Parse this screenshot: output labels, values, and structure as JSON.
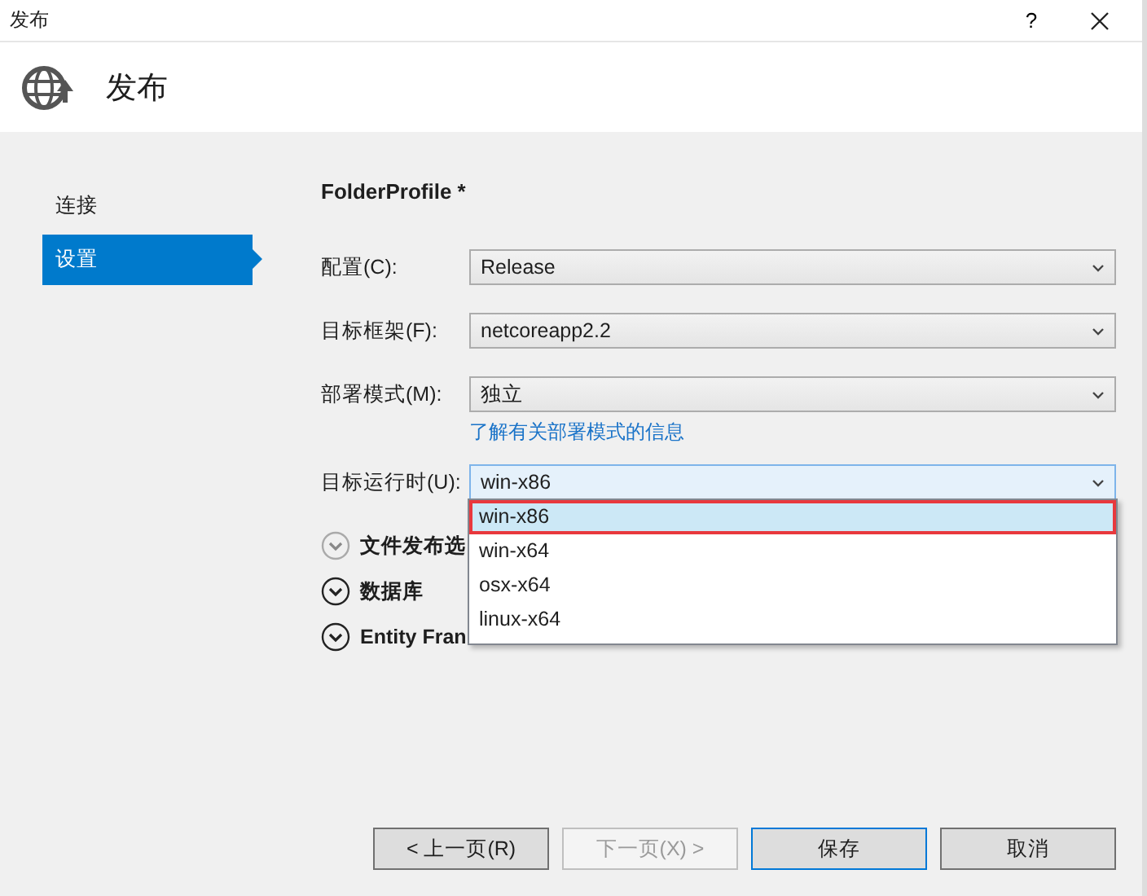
{
  "window": {
    "title": "发布",
    "help": "?"
  },
  "header": {
    "title": "发布"
  },
  "sidebar": {
    "items": [
      {
        "label": "连接",
        "selected": false
      },
      {
        "label": "设置",
        "selected": true
      }
    ]
  },
  "profile": {
    "title": "FolderProfile *"
  },
  "fields": [
    {
      "label": "配置(C):",
      "value": "Release",
      "open": false
    },
    {
      "label": "目标框架(F):",
      "value": "netcoreapp2.2",
      "open": false
    },
    {
      "label": "部署模式(M):",
      "value": "独立",
      "open": false,
      "link": "了解有关部署模式的信息"
    },
    {
      "label": "目标运行时(U):",
      "value": "win-x86",
      "open": true,
      "options": [
        {
          "label": "win-x86",
          "selected": true
        },
        {
          "label": "win-x64",
          "selected": false
        },
        {
          "label": "osx-x64",
          "selected": false
        },
        {
          "label": "linux-x64",
          "selected": false
        }
      ]
    }
  ],
  "sections": [
    {
      "label": "文件发布选",
      "disabled": true
    },
    {
      "label": "数据库",
      "disabled": false
    },
    {
      "label": "Entity Fran",
      "disabled": false
    }
  ],
  "buttons": [
    {
      "label": "< 上一页(R)",
      "disabled": false,
      "focused": false
    },
    {
      "label": "下一页(X) >",
      "disabled": true,
      "focused": false
    },
    {
      "label": "保存",
      "disabled": false,
      "focused": true
    },
    {
      "label": "取消",
      "disabled": false,
      "focused": false
    }
  ]
}
